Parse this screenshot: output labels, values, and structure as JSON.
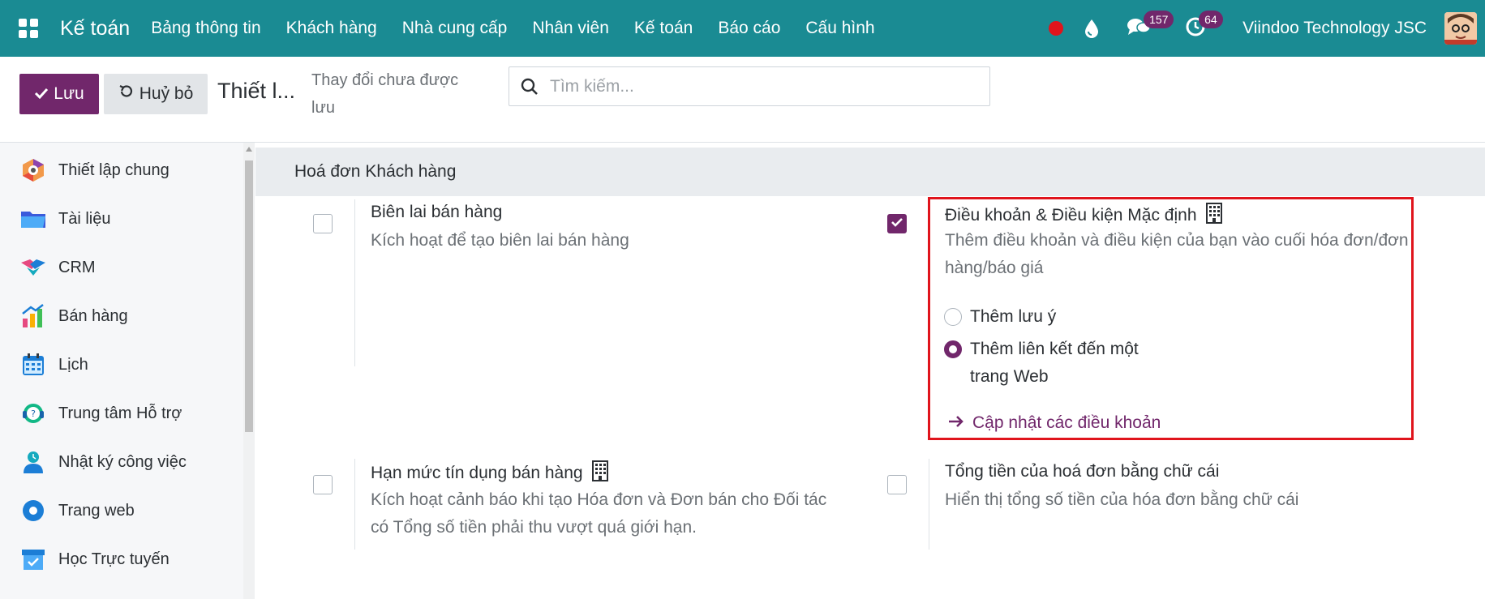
{
  "navbar": {
    "app_name": "Kế toán",
    "menu": [
      "Bảng thông tin",
      "Khách hàng",
      "Nhà cung cấp",
      "Nhân viên",
      "Kế toán",
      "Báo cáo",
      "Cấu hình"
    ],
    "messages_badge": "157",
    "activities_badge": "64",
    "company": "Viindoo Technology JSC",
    "icons": [
      "apps-grid-icon",
      "status-dot-icon",
      "drop-icon",
      "chat-icon",
      "clock-icon",
      "avatar"
    ]
  },
  "control_panel": {
    "save_label": "Lưu",
    "discard_label": "Huỷ bỏ",
    "breadcrumb": "Thiết l...",
    "unsaved_status": "Thay đổi chưa được lưu",
    "search_placeholder": "Tìm kiếm..."
  },
  "sidebar": {
    "items": [
      {
        "label": "Thiết lập chung",
        "icon": "settings-hexagon-icon"
      },
      {
        "label": "Tài liệu",
        "icon": "folder-icon"
      },
      {
        "label": "CRM",
        "icon": "crm-handshake-icon"
      },
      {
        "label": "Bán hàng",
        "icon": "sales-chart-icon"
      },
      {
        "label": "Lịch",
        "icon": "calendar-icon"
      },
      {
        "label": "Trung tâm Hỗ trợ",
        "icon": "helpdesk-headset-icon"
      },
      {
        "label": "Nhật ký công việc",
        "icon": "timesheet-person-icon"
      },
      {
        "label": "Trang web",
        "icon": "website-icon"
      },
      {
        "label": "Học Trực tuyến",
        "icon": "elearning-icon"
      }
    ]
  },
  "main": {
    "section_title": "Hoá đơn Khách hàng",
    "settings": {
      "sales_receipt": {
        "title": "Biên lai bán hàng",
        "desc": "Kích hoạt để tạo biên lai bán hàng",
        "checked": false
      },
      "default_terms": {
        "title": "Điều khoản & Điều kiện Mặc định",
        "desc": "Thêm điều khoản và điều kiện của bạn vào cuối hóa đơn/đơn hàng/báo giá",
        "checked": true,
        "options": [
          "Thêm lưu ý",
          "Thêm liên kết đến một trang Web"
        ],
        "selected_option": "Thêm liên kết đến một trang Web",
        "link_label": "Cập nhật các điều khoản"
      },
      "credit_limit": {
        "title": "Hạn mức tín dụng bán hàng",
        "desc": "Kích hoạt cảnh báo khi tạo Hóa đơn và Đơn bán cho Đối tác có Tổng số tiền phải thu vượt quá giới hạn.",
        "checked": false
      },
      "amount_in_words": {
        "title": "Tổng tiền của hoá đơn bằng chữ cái",
        "desc": "Hiển thị tổng số tiền của hóa đơn bằng chữ cái",
        "checked": false
      }
    }
  },
  "colors": {
    "navbar": "#1a8b93",
    "primary": "#71276b",
    "highlight": "#e0141c"
  }
}
